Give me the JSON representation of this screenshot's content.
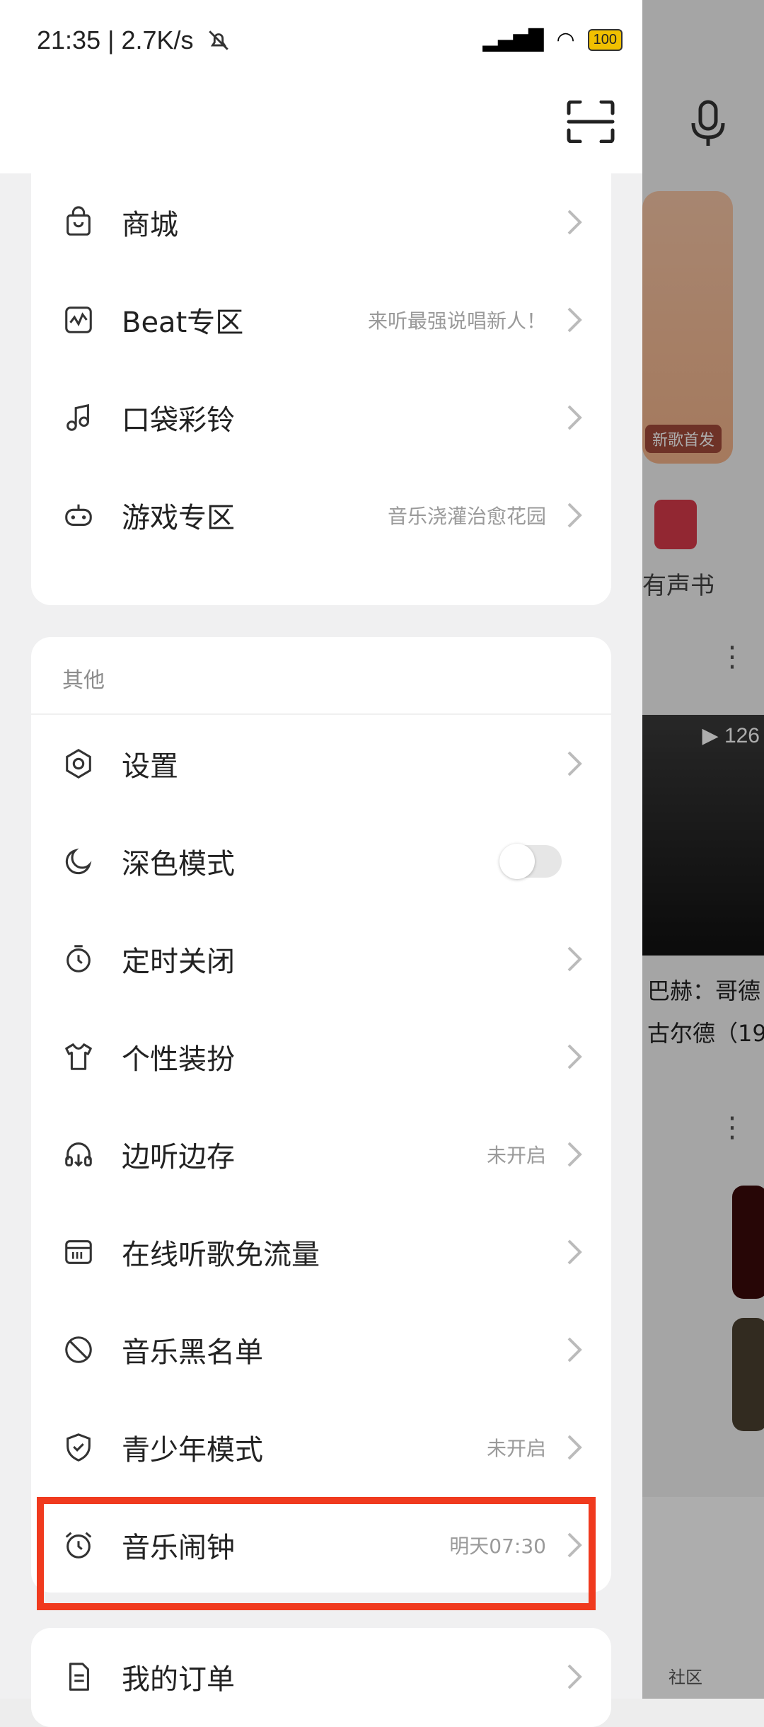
{
  "status_bar": {
    "time_speed": "21:35 | 2.7K/s",
    "battery": "100"
  },
  "menu_top": [
    {
      "label": "商城",
      "hint": ""
    },
    {
      "label": "Beat专区",
      "hint": "来听最强说唱新人！"
    },
    {
      "label": "口袋彩铃",
      "hint": ""
    },
    {
      "label": "游戏专区",
      "hint": "音乐浇灌治愈花园"
    }
  ],
  "others_section": {
    "title": "其他",
    "items": [
      {
        "label": "设置",
        "hint": ""
      },
      {
        "label": "深色模式",
        "hint": ""
      },
      {
        "label": "定时关闭",
        "hint": ""
      },
      {
        "label": "个性装扮",
        "hint": ""
      },
      {
        "label": "边听边存",
        "hint": "未开启"
      },
      {
        "label": "在线听歌免流量",
        "hint": ""
      },
      {
        "label": "音乐黑名单",
        "hint": ""
      },
      {
        "label": "青少年模式",
        "hint": "未开启"
      },
      {
        "label": "音乐闹钟",
        "hint": "明天07:30"
      }
    ]
  },
  "orders": {
    "label": "我的订单"
  },
  "background_app": {
    "new_song_tag": "新歌首发",
    "audiobook_label": "有声书",
    "play_count": "126",
    "track_text": "巴赫：哥德\n古尔德（19",
    "community_label": "社区"
  },
  "colors": {
    "highlight": "#f03a1e",
    "accent_book": "#d83a4a"
  }
}
